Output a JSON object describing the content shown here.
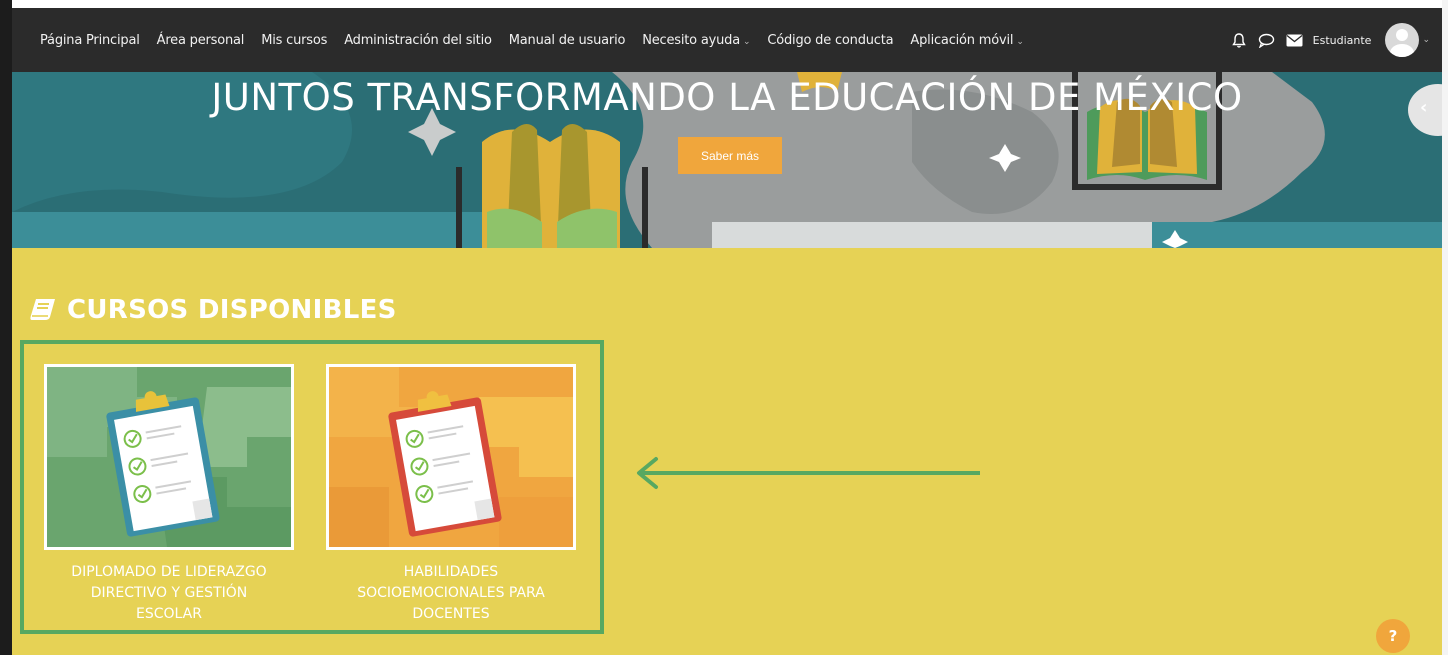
{
  "navbar": {
    "items": [
      {
        "label": "Página Principal",
        "dropdown": false
      },
      {
        "label": "Área personal",
        "dropdown": false
      },
      {
        "label": "Mis cursos",
        "dropdown": false
      },
      {
        "label": "Administración del sitio",
        "dropdown": false
      },
      {
        "label": "Manual de usuario",
        "dropdown": false
      },
      {
        "label": "Necesito ayuda",
        "dropdown": true
      },
      {
        "label": "Código de conducta",
        "dropdown": false
      },
      {
        "label": "Aplicación móvil",
        "dropdown": true
      }
    ],
    "icons": [
      "bell-icon",
      "chat-bubble-icon",
      "envelope-icon"
    ],
    "user_name": "Estudiante",
    "caret": "⌄"
  },
  "hero": {
    "title": "JUNTOS TRANSFORMANDO LA EDUCACIÓN DE MÉXICO",
    "button_label": "Saber más",
    "side_toggle": "‹"
  },
  "courses": {
    "title": "CURSOS DISPONIBLES",
    "items": [
      {
        "name": "DIPLOMADO DE LIDERAZGO DIRECTIVO Y GESTIÓN ESCOLAR",
        "lines": [
          "DIPLOMADO DE LIDERAZGO",
          "DIRECTIVO Y GESTIÓN",
          "ESCOLAR"
        ],
        "theme": "green"
      },
      {
        "name": "HABILIDADES SOCIOEMOCIONALES PARA DOCENTES",
        "lines": [
          "HABILIDADES",
          "SOCIOEMOCIONALES PARA",
          "DOCENTES"
        ],
        "theme": "orange"
      }
    ]
  },
  "help_label": "?",
  "colors": {
    "navbar": "#2b2b2b",
    "hero": "#2b6e75",
    "main_background": "#e6d255",
    "accent_orange": "#f0a63c",
    "highlight_green": "#58a861",
    "card_green": "#6aa56e",
    "card_orange": "#f0a640"
  }
}
